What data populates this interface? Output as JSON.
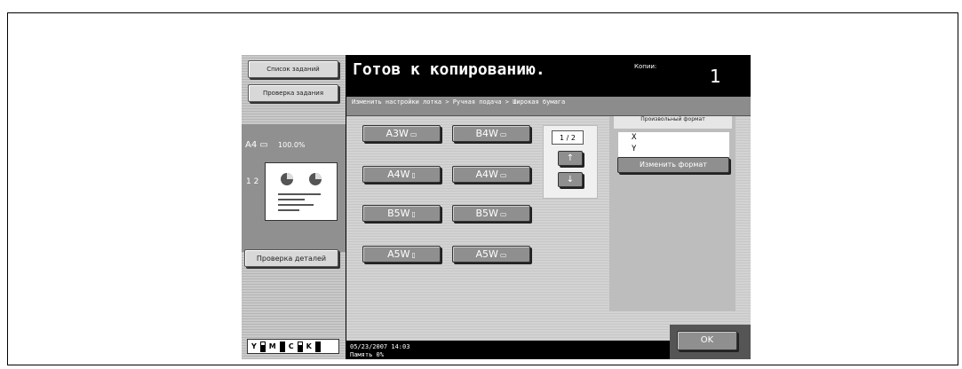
{
  "left": {
    "job_list_label": "Список заданий",
    "job_check_label": "Проверка задания",
    "paper_size": "A4",
    "paper_icon": "▭",
    "zoom": "100.0%",
    "page_icon": "1 2",
    "detail_check_label": "Проверка деталей",
    "toner": [
      {
        "letter": "Y",
        "level": "full"
      },
      {
        "letter": "M",
        "level": "full"
      },
      {
        "letter": "C",
        "level": "full"
      },
      {
        "letter": "K",
        "level": "full"
      }
    ]
  },
  "header": {
    "title": "Готов к копированию.",
    "copies_label": "Копии:",
    "copies_value": "1"
  },
  "breadcrumb": "Изменить настройки лотка > Ручная подача > Широкая бумага",
  "sizes": [
    {
      "label": "A3W",
      "orient": "landscape-icon"
    },
    {
      "label": "B4W",
      "orient": "landscape-icon"
    },
    {
      "label": "A4W",
      "orient": "portrait-icon"
    },
    {
      "label": "A4W",
      "orient": "landscape-icon"
    },
    {
      "label": "B5W",
      "orient": "portrait-icon"
    },
    {
      "label": "B5W",
      "orient": "landscape-icon"
    },
    {
      "label": "A5W",
      "orient": "portrait-icon"
    },
    {
      "label": "A5W",
      "orient": "landscape-icon"
    }
  ],
  "pager": {
    "indicator": "1 / 2",
    "up": "↑",
    "down": "↓"
  },
  "custom": {
    "header": "Произвольный формат",
    "x_label": "X",
    "y_label": "Y",
    "change_label": "Изменить формат"
  },
  "footer": {
    "datetime": "05/23/2007   14:03",
    "memory": "Память        0%"
  },
  "ok_label": "OK"
}
